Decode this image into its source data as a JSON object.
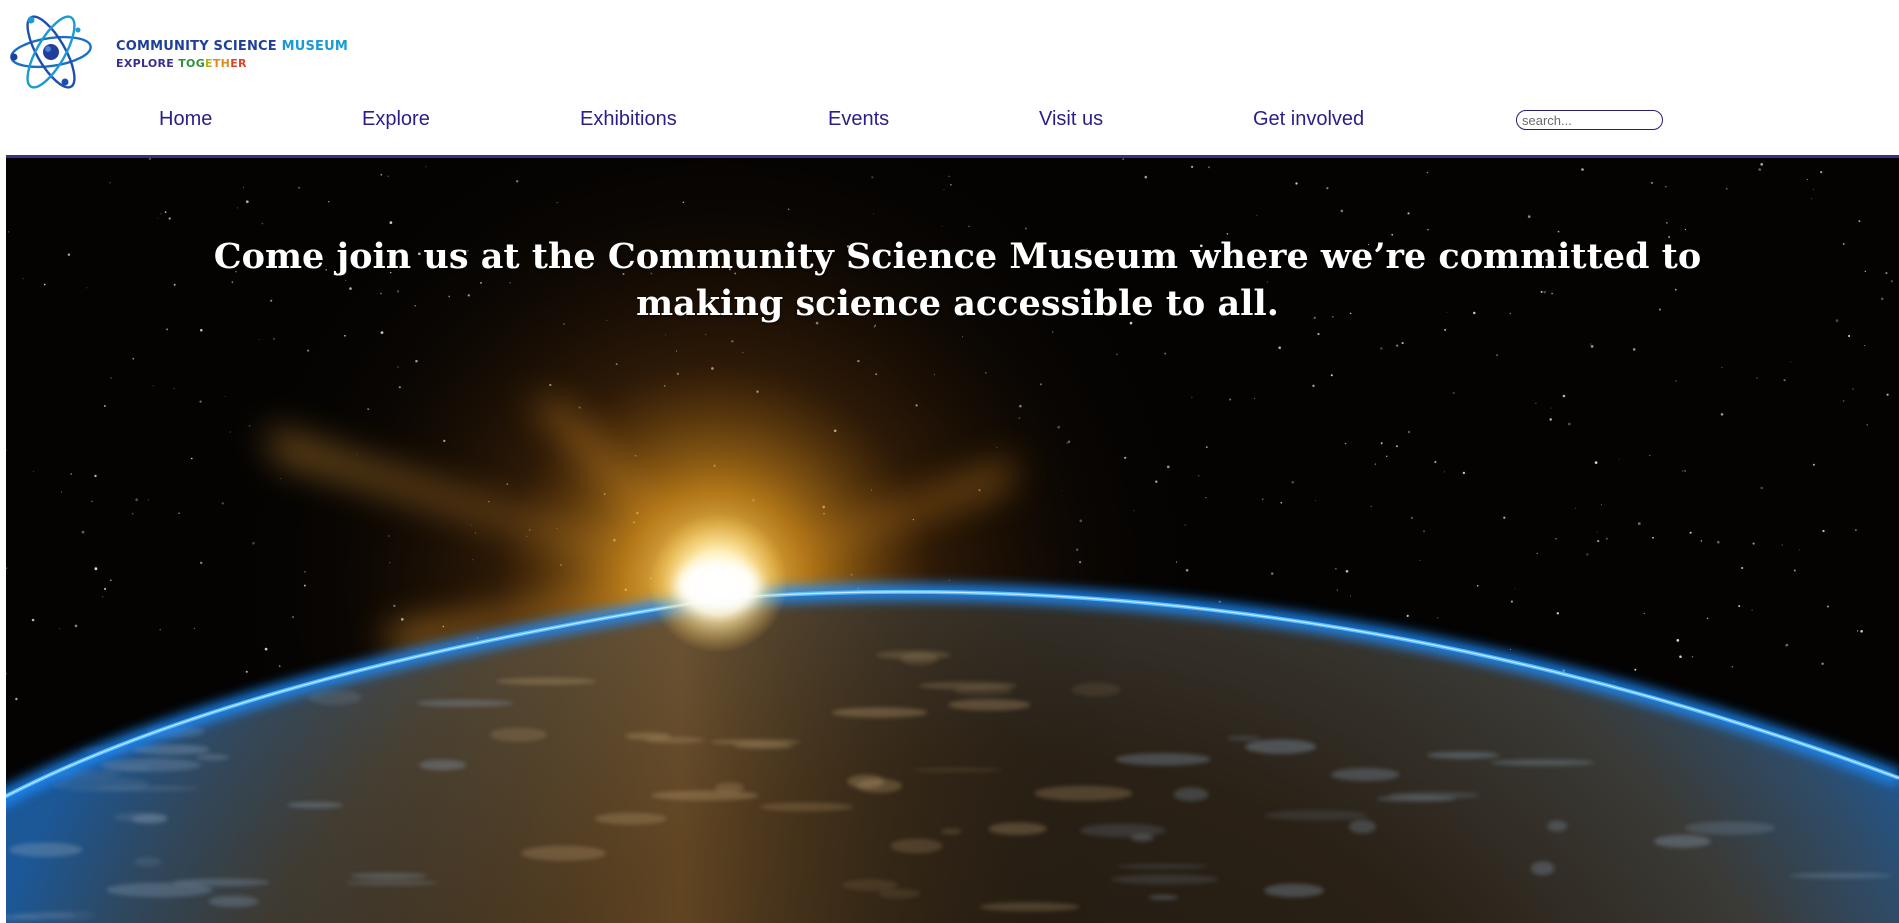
{
  "brand": {
    "name_part1": "COMMUNITY SCIENCE ",
    "name_part2": "MUSEUM",
    "tagline_1": "EXPLORE ",
    "tagline_2": "TOG",
    "tagline_3": "E",
    "tagline_4": "TH",
    "tagline_5": "ER",
    "logo_icon": "atom-icon",
    "colors": {
      "navy": "#1f3f9a",
      "sky": "#1a9ad6"
    }
  },
  "nav": {
    "items": [
      {
        "label": "Home"
      },
      {
        "label": "Explore"
      },
      {
        "label": "Exhibitions"
      },
      {
        "label": "Events"
      },
      {
        "label": "Visit us"
      },
      {
        "label": "Get involved"
      }
    ],
    "link_color": "#2a1f8a"
  },
  "search": {
    "placeholder": "search...",
    "value": ""
  },
  "hero": {
    "headline": "Come join us at the Community Science Museum where we’re committed to making science accessible to all.",
    "image": "earth-sunrise-from-space"
  }
}
